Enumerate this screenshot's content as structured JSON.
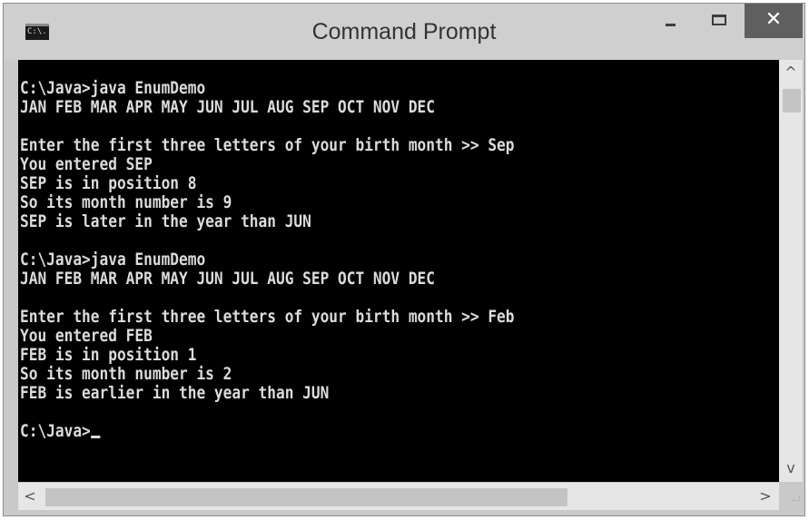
{
  "window": {
    "title": "Command Prompt",
    "icon_label": "C:\\.",
    "close_glyph": "✕"
  },
  "console": {
    "lines": [
      "C:\\Java>java EnumDemo",
      "JAN FEB MAR APR MAY JUN JUL AUG SEP OCT NOV DEC",
      "",
      "Enter the first three letters of your birth month >> Sep",
      "You entered SEP",
      "SEP is in position 8",
      "So its month number is 9",
      "SEP is later in the year than JUN",
      "",
      "C:\\Java>java EnumDemo",
      "JAN FEB MAR APR MAY JUN JUL AUG SEP OCT NOV DEC",
      "",
      "Enter the first three letters of your birth month >> Feb",
      "You entered FEB",
      "FEB is in position 1",
      "So its month number is 2",
      "FEB is earlier in the year than JUN",
      "",
      "C:\\Java>"
    ]
  },
  "scrollbars": {
    "up_arrow": "^",
    "down_arrow": "v",
    "left_arrow": "<",
    "right_arrow": ">",
    "grip": "..:"
  },
  "colors": {
    "console_bg": "#000000",
    "console_text": "#dcdcdc",
    "titlebar": "#cfcfcf",
    "close_button": "#5f5f5f"
  }
}
